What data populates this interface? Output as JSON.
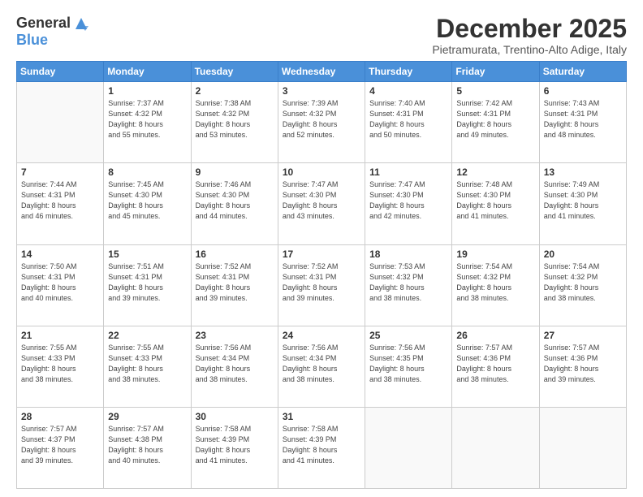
{
  "header": {
    "logo_line1": "General",
    "logo_line2": "Blue",
    "month": "December 2025",
    "location": "Pietramurata, Trentino-Alto Adige, Italy"
  },
  "weekdays": [
    "Sunday",
    "Monday",
    "Tuesday",
    "Wednesday",
    "Thursday",
    "Friday",
    "Saturday"
  ],
  "weeks": [
    [
      {
        "day": "",
        "info": ""
      },
      {
        "day": "1",
        "info": "Sunrise: 7:37 AM\nSunset: 4:32 PM\nDaylight: 8 hours\nand 55 minutes."
      },
      {
        "day": "2",
        "info": "Sunrise: 7:38 AM\nSunset: 4:32 PM\nDaylight: 8 hours\nand 53 minutes."
      },
      {
        "day": "3",
        "info": "Sunrise: 7:39 AM\nSunset: 4:32 PM\nDaylight: 8 hours\nand 52 minutes."
      },
      {
        "day": "4",
        "info": "Sunrise: 7:40 AM\nSunset: 4:31 PM\nDaylight: 8 hours\nand 50 minutes."
      },
      {
        "day": "5",
        "info": "Sunrise: 7:42 AM\nSunset: 4:31 PM\nDaylight: 8 hours\nand 49 minutes."
      },
      {
        "day": "6",
        "info": "Sunrise: 7:43 AM\nSunset: 4:31 PM\nDaylight: 8 hours\nand 48 minutes."
      }
    ],
    [
      {
        "day": "7",
        "info": "Sunrise: 7:44 AM\nSunset: 4:31 PM\nDaylight: 8 hours\nand 46 minutes."
      },
      {
        "day": "8",
        "info": "Sunrise: 7:45 AM\nSunset: 4:30 PM\nDaylight: 8 hours\nand 45 minutes."
      },
      {
        "day": "9",
        "info": "Sunrise: 7:46 AM\nSunset: 4:30 PM\nDaylight: 8 hours\nand 44 minutes."
      },
      {
        "day": "10",
        "info": "Sunrise: 7:47 AM\nSunset: 4:30 PM\nDaylight: 8 hours\nand 43 minutes."
      },
      {
        "day": "11",
        "info": "Sunrise: 7:47 AM\nSunset: 4:30 PM\nDaylight: 8 hours\nand 42 minutes."
      },
      {
        "day": "12",
        "info": "Sunrise: 7:48 AM\nSunset: 4:30 PM\nDaylight: 8 hours\nand 41 minutes."
      },
      {
        "day": "13",
        "info": "Sunrise: 7:49 AM\nSunset: 4:30 PM\nDaylight: 8 hours\nand 41 minutes."
      }
    ],
    [
      {
        "day": "14",
        "info": "Sunrise: 7:50 AM\nSunset: 4:31 PM\nDaylight: 8 hours\nand 40 minutes."
      },
      {
        "day": "15",
        "info": "Sunrise: 7:51 AM\nSunset: 4:31 PM\nDaylight: 8 hours\nand 39 minutes."
      },
      {
        "day": "16",
        "info": "Sunrise: 7:52 AM\nSunset: 4:31 PM\nDaylight: 8 hours\nand 39 minutes."
      },
      {
        "day": "17",
        "info": "Sunrise: 7:52 AM\nSunset: 4:31 PM\nDaylight: 8 hours\nand 39 minutes."
      },
      {
        "day": "18",
        "info": "Sunrise: 7:53 AM\nSunset: 4:32 PM\nDaylight: 8 hours\nand 38 minutes."
      },
      {
        "day": "19",
        "info": "Sunrise: 7:54 AM\nSunset: 4:32 PM\nDaylight: 8 hours\nand 38 minutes."
      },
      {
        "day": "20",
        "info": "Sunrise: 7:54 AM\nSunset: 4:32 PM\nDaylight: 8 hours\nand 38 minutes."
      }
    ],
    [
      {
        "day": "21",
        "info": "Sunrise: 7:55 AM\nSunset: 4:33 PM\nDaylight: 8 hours\nand 38 minutes."
      },
      {
        "day": "22",
        "info": "Sunrise: 7:55 AM\nSunset: 4:33 PM\nDaylight: 8 hours\nand 38 minutes."
      },
      {
        "day": "23",
        "info": "Sunrise: 7:56 AM\nSunset: 4:34 PM\nDaylight: 8 hours\nand 38 minutes."
      },
      {
        "day": "24",
        "info": "Sunrise: 7:56 AM\nSunset: 4:34 PM\nDaylight: 8 hours\nand 38 minutes."
      },
      {
        "day": "25",
        "info": "Sunrise: 7:56 AM\nSunset: 4:35 PM\nDaylight: 8 hours\nand 38 minutes."
      },
      {
        "day": "26",
        "info": "Sunrise: 7:57 AM\nSunset: 4:36 PM\nDaylight: 8 hours\nand 38 minutes."
      },
      {
        "day": "27",
        "info": "Sunrise: 7:57 AM\nSunset: 4:36 PM\nDaylight: 8 hours\nand 39 minutes."
      }
    ],
    [
      {
        "day": "28",
        "info": "Sunrise: 7:57 AM\nSunset: 4:37 PM\nDaylight: 8 hours\nand 39 minutes."
      },
      {
        "day": "29",
        "info": "Sunrise: 7:57 AM\nSunset: 4:38 PM\nDaylight: 8 hours\nand 40 minutes."
      },
      {
        "day": "30",
        "info": "Sunrise: 7:58 AM\nSunset: 4:39 PM\nDaylight: 8 hours\nand 41 minutes."
      },
      {
        "day": "31",
        "info": "Sunrise: 7:58 AM\nSunset: 4:39 PM\nDaylight: 8 hours\nand 41 minutes."
      },
      {
        "day": "",
        "info": ""
      },
      {
        "day": "",
        "info": ""
      },
      {
        "day": "",
        "info": ""
      }
    ]
  ]
}
